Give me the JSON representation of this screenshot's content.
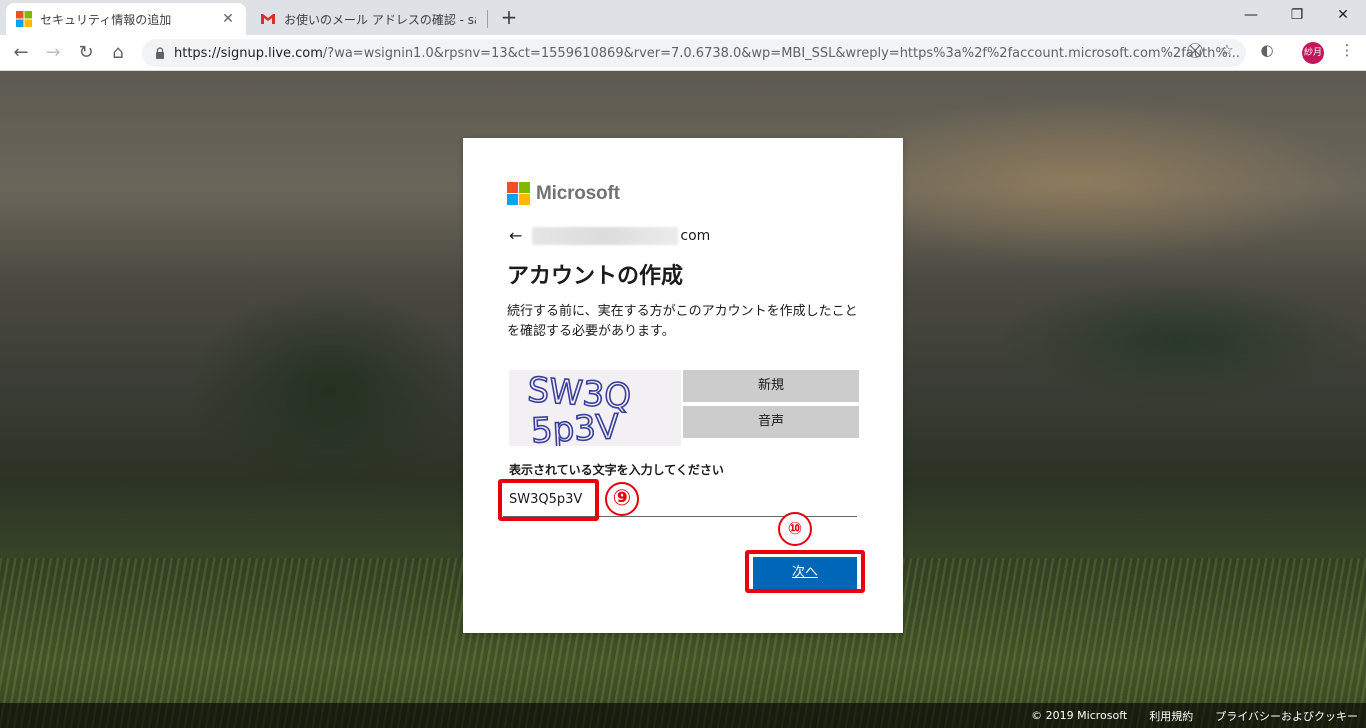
{
  "browser": {
    "tabs": [
      {
        "title": "セキュリティ情報の追加",
        "active": true
      },
      {
        "title": "お使いのメール アドレスの確認 - satsu",
        "active": false
      }
    ],
    "url_host": "https://signup.live.com",
    "url_rest": "/?wa=wsignin1.0&rpsnv=13&ct=1559610869&rver=7.0.6738.0&wp=MBI_SSL&wreply=https%3a%2f%2faccount.microsoft.com%2fauth%...",
    "profile_label": "紗月"
  },
  "card": {
    "brand": "Microsoft",
    "email_suffix": "com",
    "heading": "アカウントの作成",
    "description": "続行する前に、実在する方がこのアカウントを作成したことを確認する必要があります。",
    "captcha_text_line1": "SW3Q",
    "captcha_text_line2": "5p3V",
    "new_button": "新規",
    "audio_button": "音声",
    "field_label": "表示されている文字を入力してください",
    "field_value": "SW3Q5p3V",
    "next_button": "次へ"
  },
  "annotations": {
    "step9": "⑨",
    "step10": "⑩"
  },
  "footer": {
    "copyright": "© 2019 Microsoft",
    "terms": "利用規約",
    "privacy": "プライバシーおよびクッキー"
  },
  "colors": {
    "accent_blue": "#0067b8",
    "highlight_red": "#e8000e",
    "ms_red": "#f25022",
    "ms_green": "#7fba00",
    "ms_blue": "#00a4ef",
    "ms_yellow": "#ffb900"
  }
}
